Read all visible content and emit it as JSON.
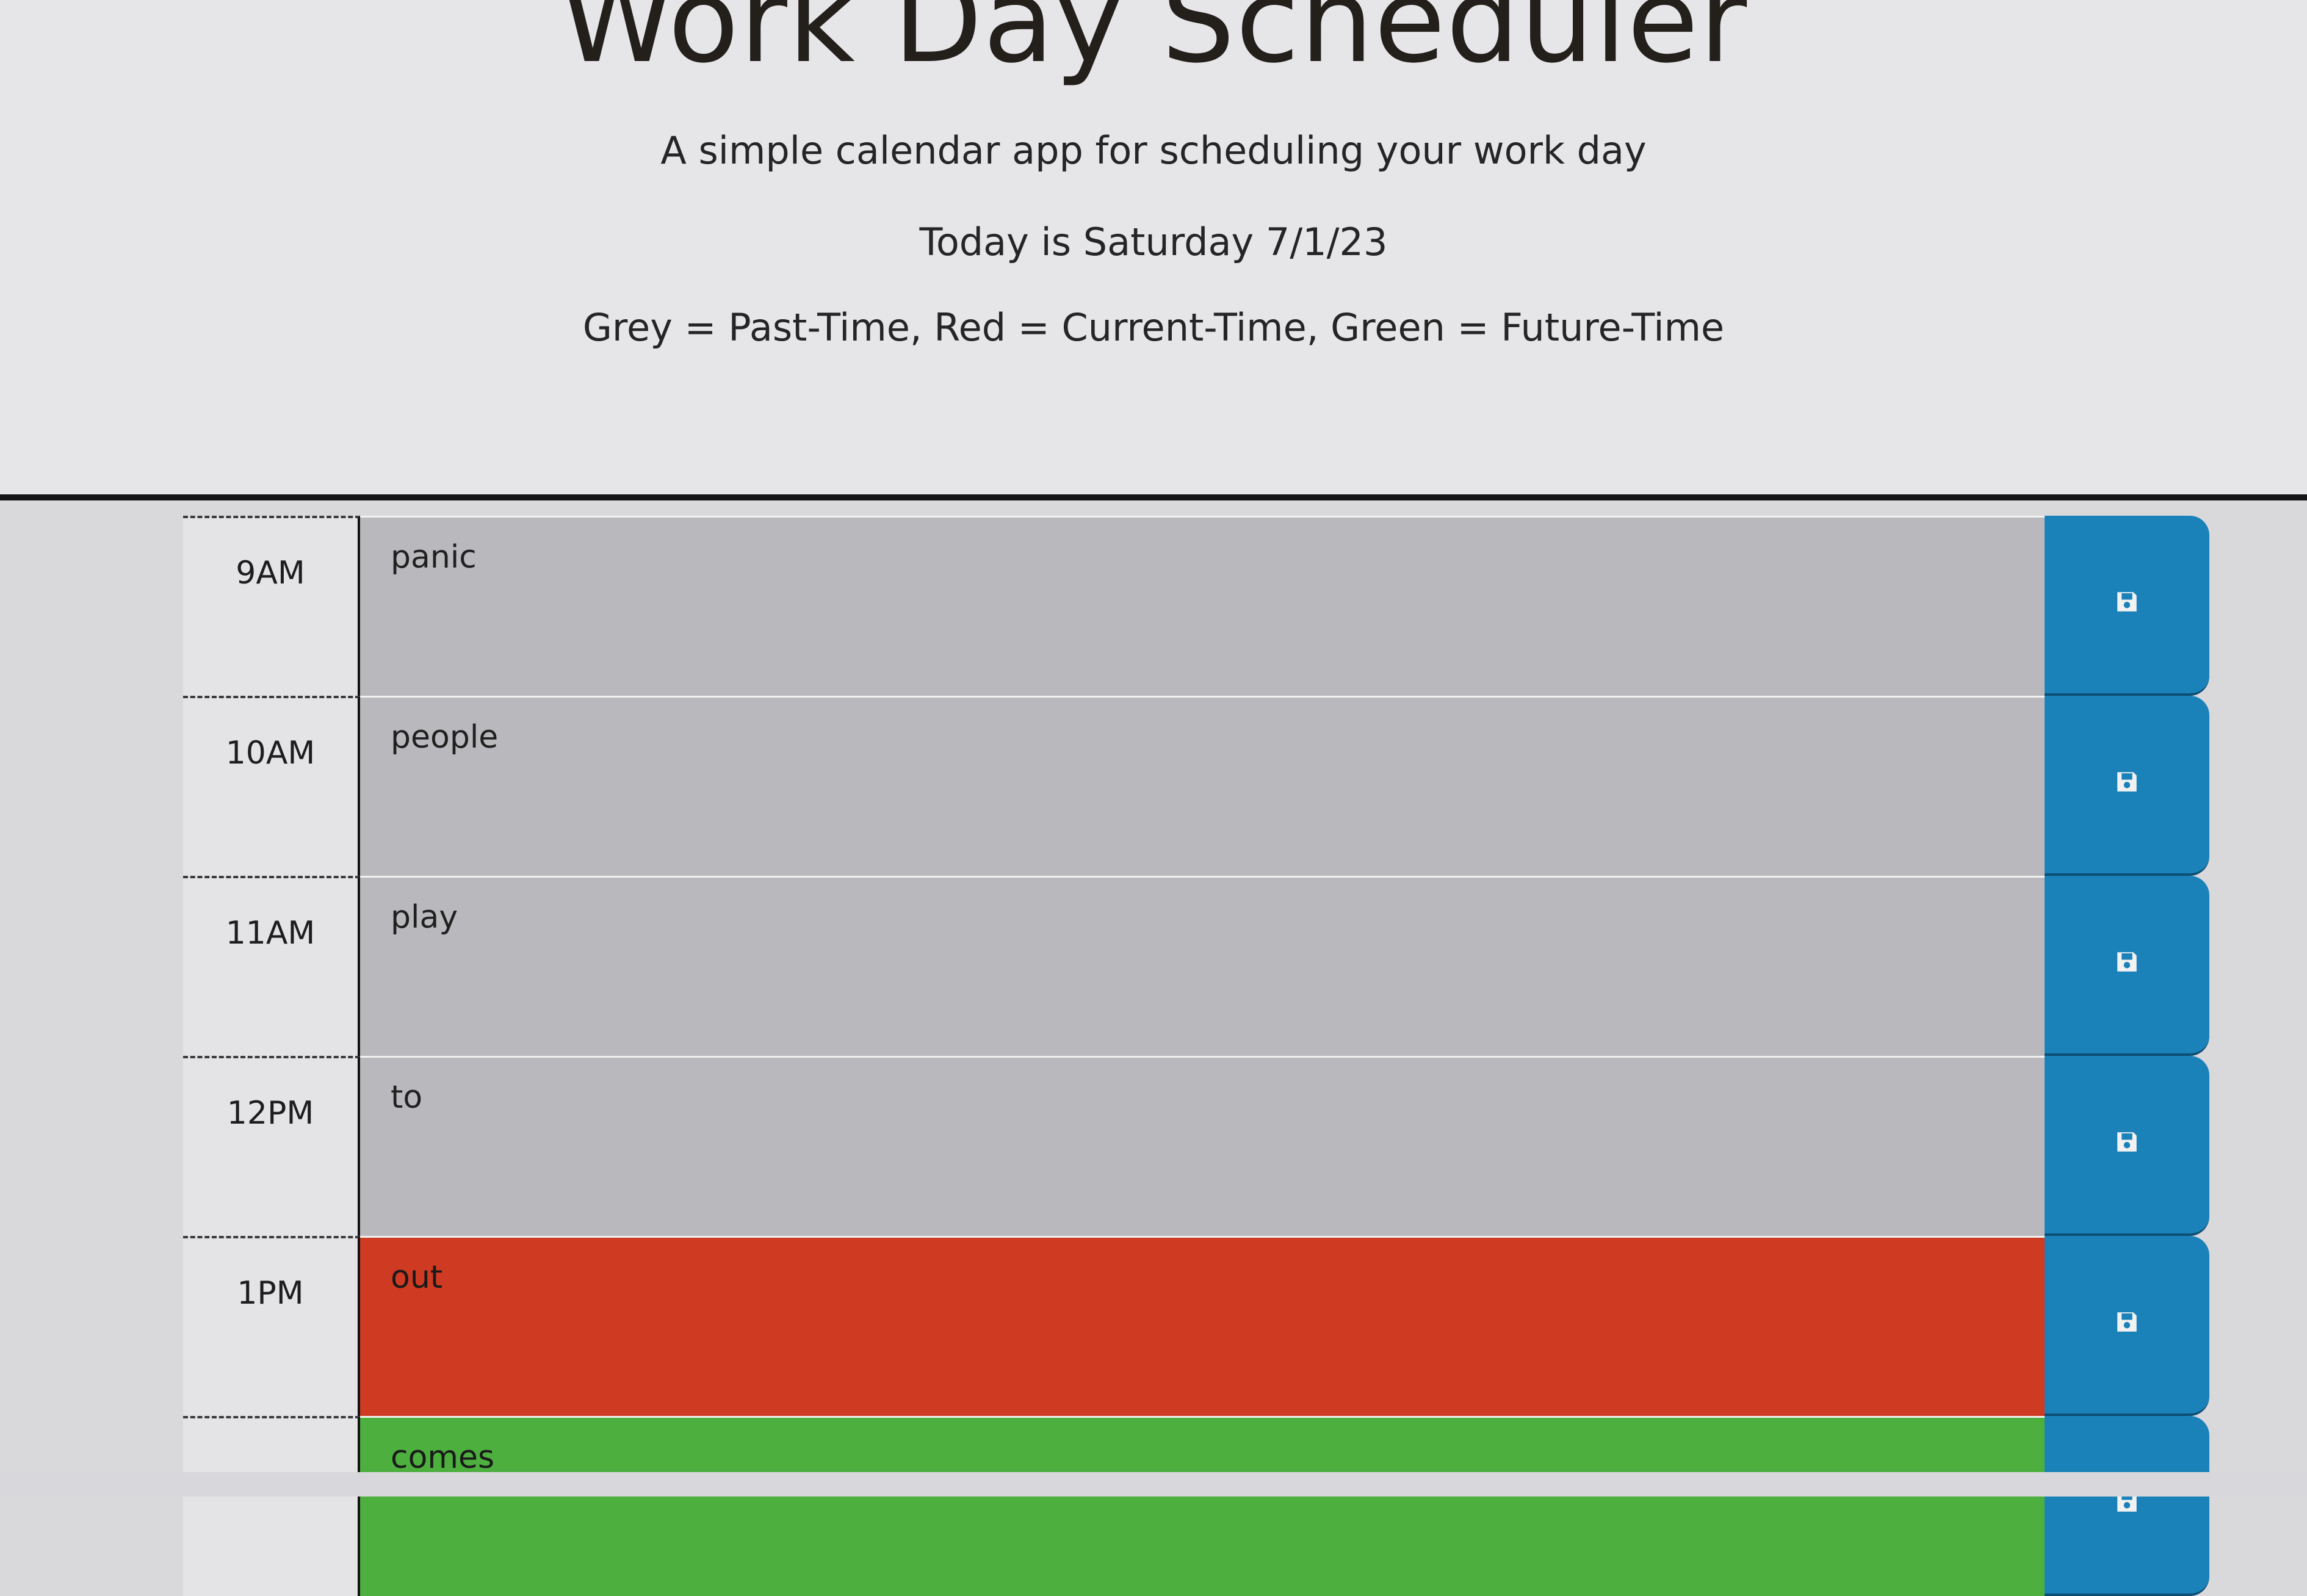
{
  "header": {
    "title": "Work Day Scheduler",
    "lead": "A simple calendar app for scheduling your work day",
    "current_day": "Today is Saturday 7/1/23",
    "legend": "Grey = Past-Time, Red = Current-Time, Green = Future-Time"
  },
  "colors": {
    "past": "#b9b9bd",
    "present": "#cf3a22",
    "future": "#4caf3e",
    "save_button": "#1b82b9"
  },
  "time_blocks": [
    {
      "hour": "9AM",
      "text": "panic",
      "state": "past"
    },
    {
      "hour": "10AM",
      "text": "people",
      "state": "past"
    },
    {
      "hour": "11AM",
      "text": "play",
      "state": "past"
    },
    {
      "hour": "12PM",
      "text": "to",
      "state": "past"
    },
    {
      "hour": "1PM",
      "text": "out",
      "state": "present"
    },
    {
      "hour": "",
      "text": "comes",
      "state": "future"
    }
  ],
  "icons": {
    "save": "floppy-disk-icon"
  }
}
